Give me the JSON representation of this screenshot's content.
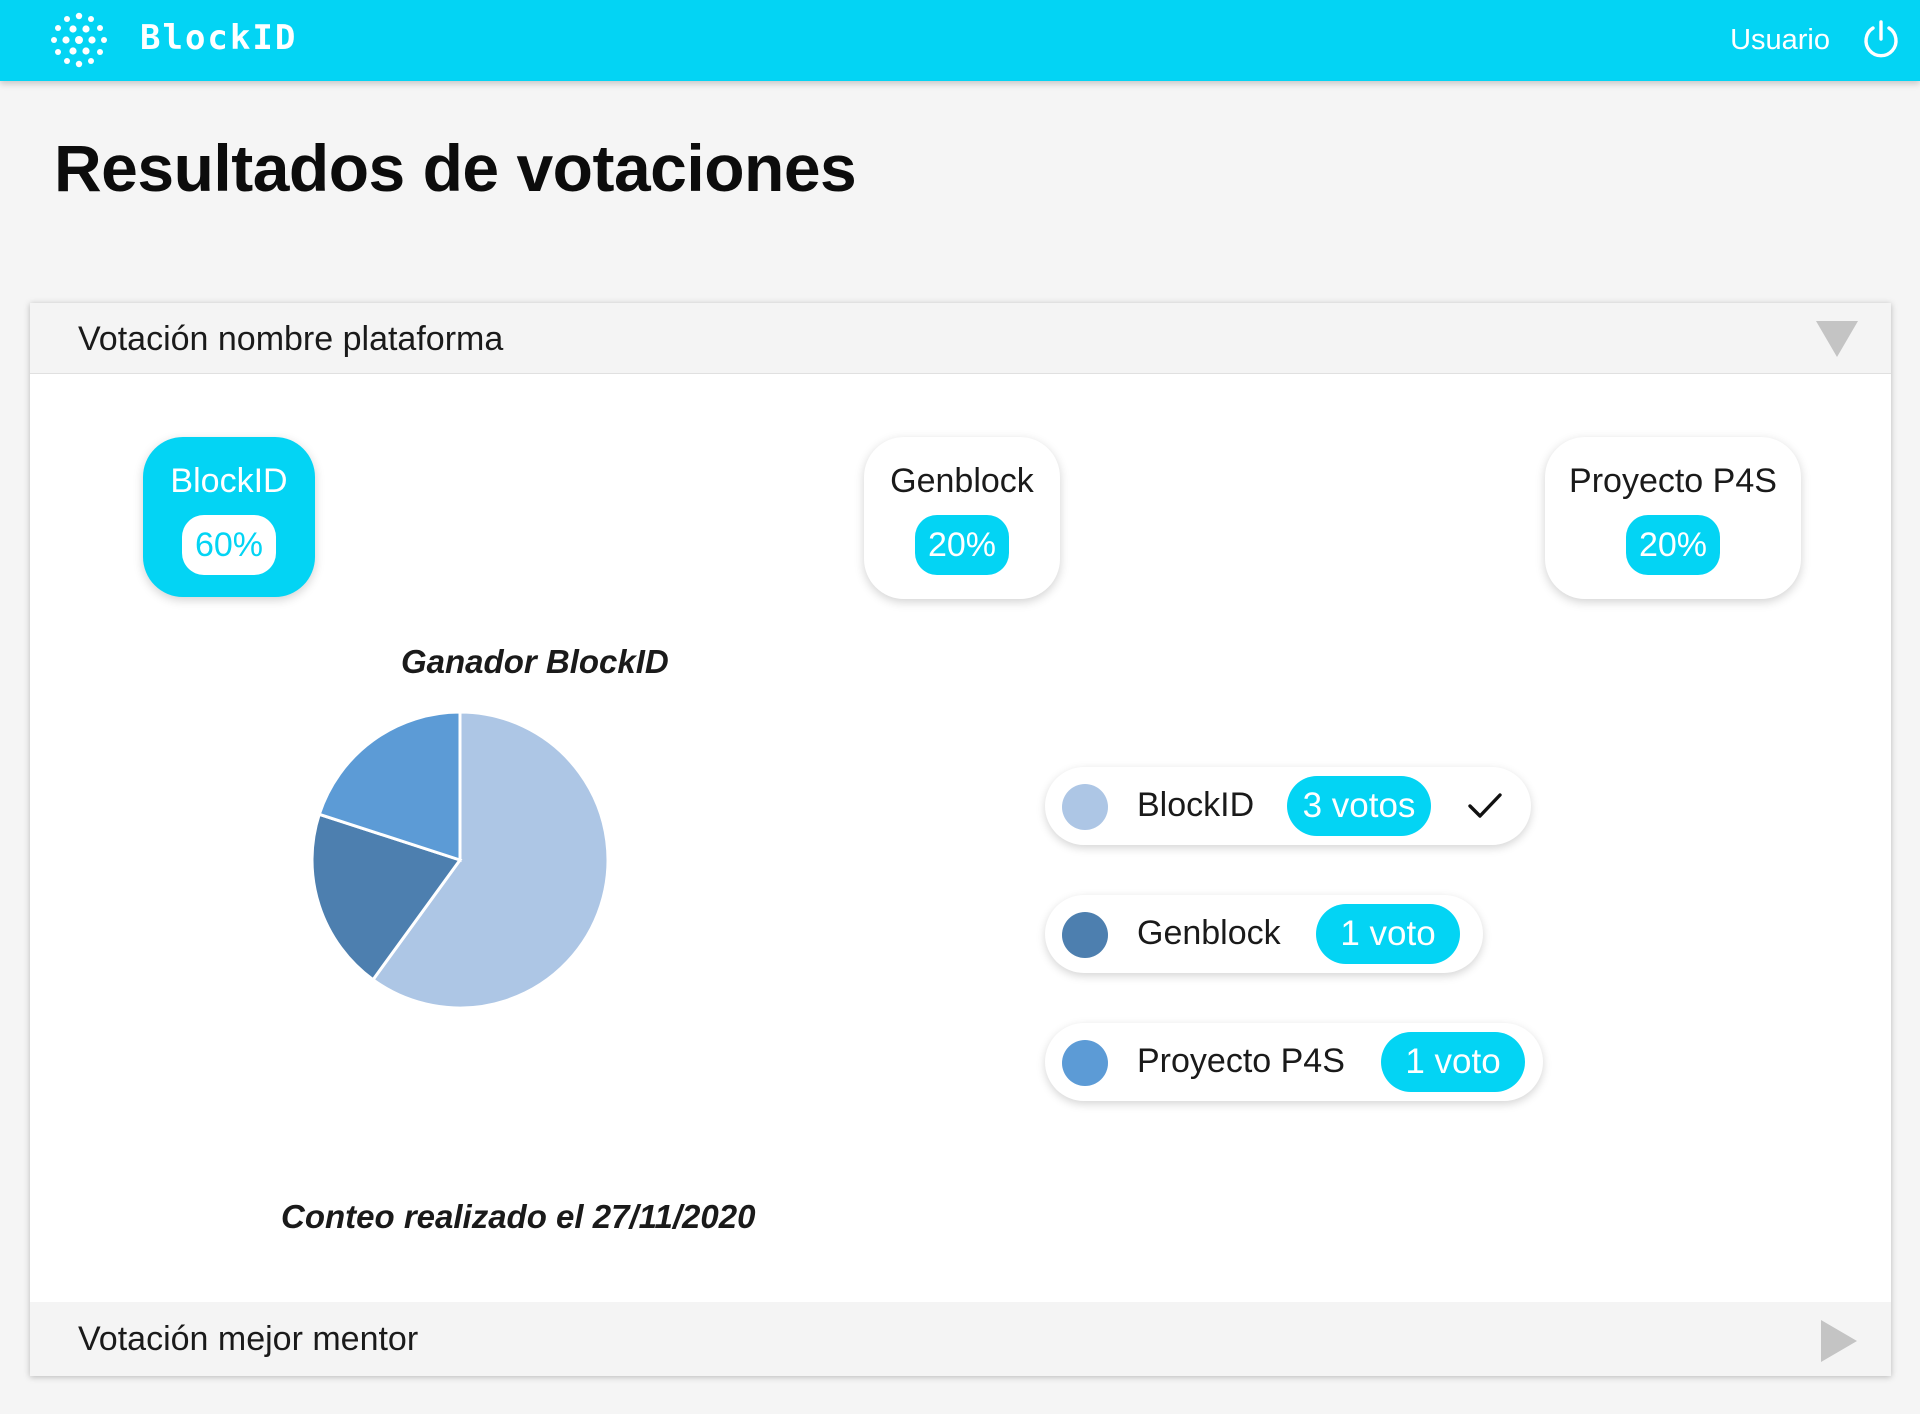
{
  "app": {
    "brand": "BlockID",
    "user_label": "Usuario",
    "colors": {
      "accent": "#03d4f4",
      "winner_slice": "#adc6e5",
      "second_slice": "#4d7faf",
      "third_slice": "#5c9bd6"
    },
    "icons": {
      "logo": "network-globe-icon",
      "power": "power-icon",
      "check": "check-icon"
    }
  },
  "page": {
    "title": "Resultados de votaciones"
  },
  "votes": [
    {
      "title": "Votación nombre plataforma",
      "expanded": true,
      "options": [
        {
          "name": "BlockID",
          "percent": "60%",
          "winner": true
        },
        {
          "name": "Genblock",
          "percent": "20%",
          "winner": false
        },
        {
          "name": "Proyecto P4S",
          "percent": "20%",
          "winner": false
        }
      ],
      "winner_caption": "Ganador BlockID",
      "count_caption": "Conteo realizado el 27/11/2020",
      "legend": [
        {
          "name": "BlockID",
          "votes_label": "3 votos",
          "color": "#adc6e5",
          "winner": true
        },
        {
          "name": "Genblock",
          "votes_label": "1 voto",
          "color": "#4d7faf",
          "winner": false
        },
        {
          "name": "Proyecto P4S",
          "votes_label": "1 voto",
          "color": "#5c9bd6",
          "winner": false
        }
      ]
    },
    {
      "title": "Votación mejor mentor",
      "expanded": false
    }
  ],
  "chart_data": {
    "type": "pie",
    "categories": [
      "BlockID",
      "Genblock",
      "Proyecto P4S"
    ],
    "values": [
      3,
      1,
      1
    ],
    "colors": [
      "#adc6e5",
      "#4d7faf",
      "#5c9bd6"
    ],
    "title": "Ganador BlockID"
  }
}
